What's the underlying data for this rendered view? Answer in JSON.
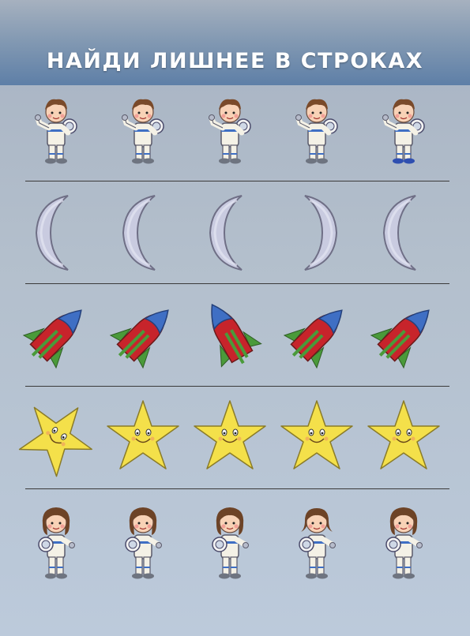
{
  "title": "НАЙДИ ЛИШНЕЕ В СТРОКАХ",
  "colors": {
    "header_top": "#a6b1bf",
    "header_bottom": "#5e7fa7",
    "background": "#b3bfcc",
    "moon": "#c9cbe0",
    "rocket_red": "#c7242b",
    "rocket_blue": "#3f6fc4",
    "rocket_green": "#4a9a3a",
    "star": "#f4e04a"
  },
  "rows": [
    {
      "name": "boy-astronauts",
      "icon": "boy-astronaut-icon",
      "odd_index": 4,
      "odd_trait": "blue-boots"
    },
    {
      "name": "moons",
      "icon": "crescent-moon-icon",
      "odd_index": 3,
      "odd_trait": "mirrored"
    },
    {
      "name": "rockets",
      "icon": "rocket-icon",
      "odd_index": 2,
      "odd_trait": "rotated"
    },
    {
      "name": "stars",
      "icon": "star-icon",
      "odd_index": 0,
      "odd_trait": "rotated"
    },
    {
      "name": "girl-astronauts",
      "icon": "girl-astronaut-icon",
      "odd_index": 3,
      "odd_trait": "different-hair"
    }
  ]
}
